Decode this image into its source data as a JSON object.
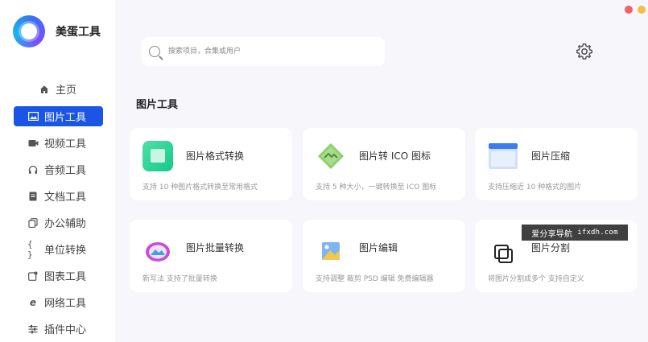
{
  "app": {
    "name": "美蛋工具"
  },
  "sidebar": {
    "items": [
      {
        "label": "主页",
        "icon": "home-icon"
      },
      {
        "label": "图片工具",
        "icon": "image-icon",
        "active": true
      },
      {
        "label": "视频工具",
        "icon": "video-icon"
      },
      {
        "label": "音频工具",
        "icon": "headphones-icon"
      },
      {
        "label": "文档工具",
        "icon": "document-icon"
      },
      {
        "label": "办公辅助",
        "icon": "copy-icon"
      },
      {
        "label": "单位转换",
        "icon": "braces-icon"
      },
      {
        "label": "图表工具",
        "icon": "chart-icon"
      },
      {
        "label": "网络工具",
        "icon": "ie-icon"
      },
      {
        "label": "插件中心",
        "icon": "sliders-icon"
      }
    ]
  },
  "search": {
    "placeholder": "搜索项目，合集或用户"
  },
  "section": {
    "title": "图片工具"
  },
  "cards": [
    {
      "title": "图片格式转换",
      "desc": "支持 10 种图片格式转换至常用格式",
      "icon": "format-convert-icon"
    },
    {
      "title": "图片转 ICO 图标",
      "desc": "支持 5 种大小，一键转换至 ICO 图标",
      "icon": "ico-convert-icon"
    },
    {
      "title": "图片压缩",
      "desc": "支持压缩近 10 种格式的图片",
      "icon": "compress-icon"
    },
    {
      "title": "图片批量转换",
      "desc": "新写法 支持了批量转换",
      "icon": "batch-convert-icon"
    },
    {
      "title": "图片编辑",
      "desc": "支持调整 裁剪 PSD 编辑 免费编辑器",
      "icon": "edit-image-icon"
    },
    {
      "title": "图片分割",
      "desc": "将图片分割成多个 支持自定义",
      "icon": "split-icon"
    }
  ],
  "watermark": {
    "text": "爱分享导航",
    "url": "ifxdh.com"
  },
  "colors": {
    "accent": "#1a55e6",
    "close": "#f46068",
    "minimize": "#f5bc4a"
  }
}
